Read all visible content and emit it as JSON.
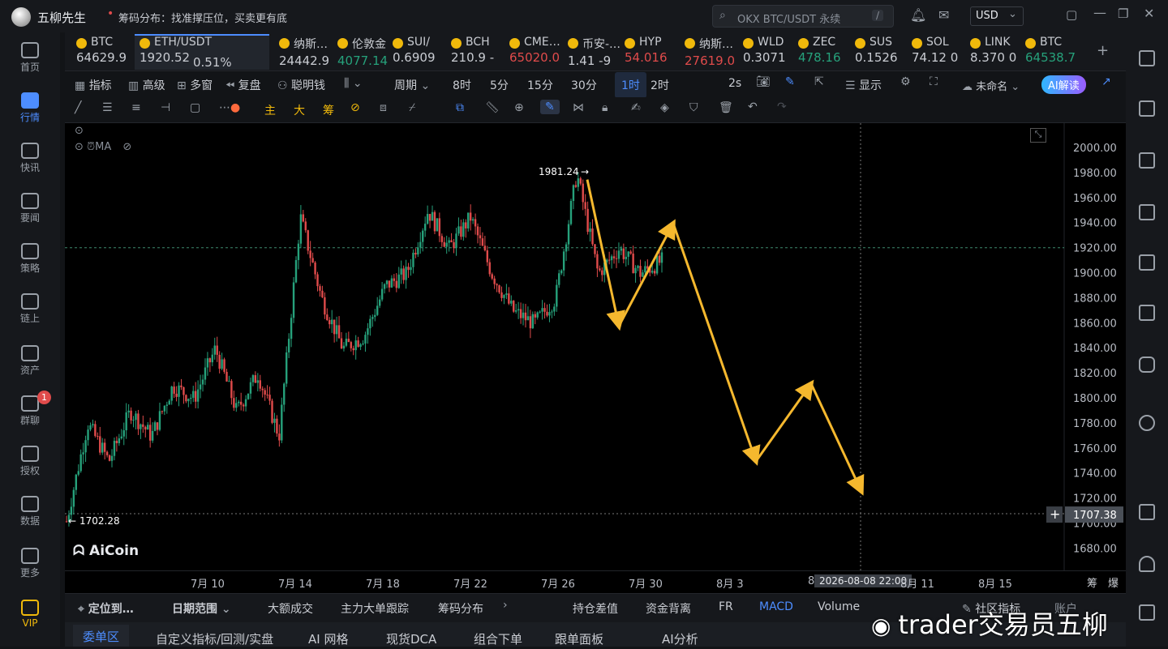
{
  "app": {
    "title": "五柳先生",
    "notice": "筹码分布：找准撑压位，买卖更有底",
    "search_placeholder": "OKX BTC/USDT 永续",
    "search_shortcut": "/",
    "currency": "USD"
  },
  "sidebar": [
    {
      "label": "首页"
    },
    {
      "label": "行情"
    },
    {
      "label": "快讯"
    },
    {
      "label": "要闻"
    },
    {
      "label": "策略"
    },
    {
      "label": "链上"
    },
    {
      "label": "资产"
    },
    {
      "label": "群聊",
      "badge": "1"
    },
    {
      "label": "授权"
    },
    {
      "label": "数据"
    },
    {
      "label": "更多"
    },
    {
      "label": "VIP"
    }
  ],
  "tickers": [
    {
      "name": "BTC",
      "price": "64629.9",
      "color": "#c9ccd2"
    },
    {
      "name": "ETH/USDT",
      "price": "1920.52",
      "change": "0.51%",
      "color": "#c9ccd2"
    },
    {
      "name": "纳斯…",
      "price": "24442.9",
      "color": "#c9ccd2"
    },
    {
      "name": "伦敦金",
      "price": "4077.14",
      "color": "#26a17b"
    },
    {
      "name": "SUI/",
      "price": "0.6909",
      "color": "#c9ccd2"
    },
    {
      "name": "BCH",
      "price": "210.9 -",
      "color": "#c9ccd2"
    },
    {
      "name": "CME…",
      "price": "65020.0",
      "color": "#e04b4b"
    },
    {
      "name": "币安-…",
      "price": "1.41 -9",
      "color": "#c9ccd2"
    },
    {
      "name": "HYP",
      "price": "54.016",
      "color": "#e04b4b"
    },
    {
      "name": "纳斯…",
      "price": "27619.0",
      "color": "#e04b4b"
    },
    {
      "name": "WLD",
      "price": "0.3071",
      "color": "#c9ccd2"
    },
    {
      "name": "ZEC",
      "price": "478.16",
      "color": "#26a17b"
    },
    {
      "name": "SUS",
      "price": "0.1526",
      "color": "#c9ccd2"
    },
    {
      "name": "SOL",
      "price": "74.12 0",
      "color": "#c9ccd2"
    },
    {
      "name": "LINK",
      "price": "8.370 0",
      "color": "#c9ccd2"
    },
    {
      "name": "BTC",
      "price": "64538.7",
      "color": "#26a17b"
    }
  ],
  "toolbar": {
    "indicators": "指标",
    "advanced": "高级",
    "multiwin": "多窗",
    "replay": "复盘",
    "smart": "聪明钱",
    "period": "周期",
    "periods": [
      "8时",
      "5分",
      "15分",
      "30分",
      "1时",
      "2时"
    ],
    "active_period": "1时",
    "interval": "2s",
    "display": "显示",
    "unnamed": "未命名",
    "ai": "AI解读"
  },
  "drawbar": [
    "主",
    "大",
    "筹"
  ],
  "chart": {
    "ma_label": "MA",
    "high_label": "1981.24",
    "low_label": "1702.28",
    "last_price": "1707.38",
    "crosshair_time": "2026-08-08 22:00",
    "watermark": "AiCoin"
  },
  "chart_data": {
    "type": "candlestick",
    "symbol": "ETH/USDT",
    "interval": "1h",
    "y_ticks": [
      2000,
      1980,
      1960,
      1940,
      1920,
      1900,
      1880,
      1860,
      1840,
      1820,
      1800,
      1780,
      1760,
      1740,
      1720,
      1700,
      1680
    ],
    "y_tick_labels": [
      "2000.00",
      "1980.00",
      "1960.00",
      "1940.00",
      "1920.00",
      "1900.00",
      "1880.00",
      "1860.00",
      "1840.00",
      "1820.00",
      "1800.00",
      "1780.00",
      "1760.00",
      "1740.00",
      "1720.00",
      "1700.00",
      "1680.00"
    ],
    "x_tick_labels": [
      "7月 10",
      "7月 14",
      "7月 18",
      "7月 22",
      "7月 26",
      "7月 30",
      "8月 3",
      "8",
      "8月 11",
      "8月 15"
    ],
    "high": 1981.24,
    "low": 1702.28,
    "current": 1920.52,
    "path": [
      1702,
      1780,
      1750,
      1790,
      1770,
      1810,
      1800,
      1840,
      1790,
      1820,
      1770,
      1945,
      1880,
      1840,
      1850,
      1890,
      1900,
      1950,
      1920,
      1945,
      1900,
      1870,
      1860,
      1880,
      1980,
      1900,
      1920,
      1900,
      1910
    ],
    "projection": [
      [
        1858,
        1868
      ],
      [
        1940,
        1938
      ],
      [
        1750,
        1745
      ],
      [
        1810,
        1812
      ],
      [
        1730,
        1726
      ]
    ]
  },
  "bottombar": {
    "locate": "定位到…",
    "date_range": "日期范围",
    "items": [
      "大额成交",
      "主力大单跟踪",
      "筹码分布",
      "持仓差值",
      "资金背离",
      "FR",
      "MACD",
      "Volume"
    ],
    "community": "社区指标",
    "account": "账户"
  },
  "bottomtabs": [
    "委单区",
    "自定义指标/回测/实盘",
    "AI 网格",
    "现货DCA",
    "组合下单",
    "跟单面板",
    "AI分析"
  ],
  "overlay": {
    "weibo": "trader交易员五柳"
  },
  "right_panel": {
    "depth": "筹",
    "liq": "爆"
  }
}
